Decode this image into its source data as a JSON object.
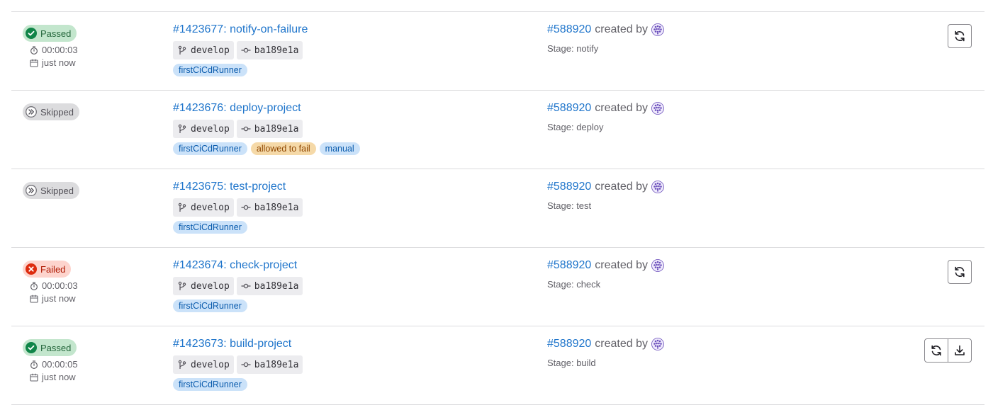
{
  "jobs": [
    {
      "status": "passed",
      "status_label": "Passed",
      "duration": "00:00:03",
      "finished": "just now",
      "title": "#1423677: notify-on-failure",
      "branch": "develop",
      "commit": "ba189e1a",
      "tags": [
        {
          "label": "firstCiCdRunner",
          "color": "blue"
        }
      ],
      "pipeline": "#588920",
      "created_by": "created by",
      "stage": "Stage: notify",
      "actions": [
        "retry-icon"
      ]
    },
    {
      "status": "skipped",
      "status_label": "Skipped",
      "duration": null,
      "finished": null,
      "title": "#1423676: deploy-project",
      "branch": "develop",
      "commit": "ba189e1a",
      "tags": [
        {
          "label": "firstCiCdRunner",
          "color": "blue"
        },
        {
          "label": "allowed to fail",
          "color": "orange"
        },
        {
          "label": "manual",
          "color": "blue"
        }
      ],
      "pipeline": "#588920",
      "created_by": "created by",
      "stage": "Stage: deploy",
      "actions": []
    },
    {
      "status": "skipped",
      "status_label": "Skipped",
      "duration": null,
      "finished": null,
      "title": "#1423675: test-project",
      "branch": "develop",
      "commit": "ba189e1a",
      "tags": [
        {
          "label": "firstCiCdRunner",
          "color": "blue"
        }
      ],
      "pipeline": "#588920",
      "created_by": "created by",
      "stage": "Stage: test",
      "actions": []
    },
    {
      "status": "failed",
      "status_label": "Failed",
      "duration": "00:00:03",
      "finished": "just now",
      "title": "#1423674: check-project",
      "branch": "develop",
      "commit": "ba189e1a",
      "tags": [
        {
          "label": "firstCiCdRunner",
          "color": "blue"
        }
      ],
      "pipeline": "#588920",
      "created_by": "created by",
      "stage": "Stage: check",
      "actions": [
        "retry-icon"
      ]
    },
    {
      "status": "passed",
      "status_label": "Passed",
      "duration": "00:00:05",
      "finished": "just now",
      "title": "#1423673: build-project",
      "branch": "develop",
      "commit": "ba189e1a",
      "tags": [
        {
          "label": "firstCiCdRunner",
          "color": "blue"
        }
      ],
      "pipeline": "#588920",
      "created_by": "created by",
      "stage": "Stage: build",
      "actions": [
        "retry-icon",
        "download-icon"
      ]
    }
  ],
  "colors": {
    "passed": "#108548",
    "failed": "#dd2b0e",
    "skipped": "#737278",
    "link": "#1f75cb",
    "avatar": "#6b4fbb"
  }
}
